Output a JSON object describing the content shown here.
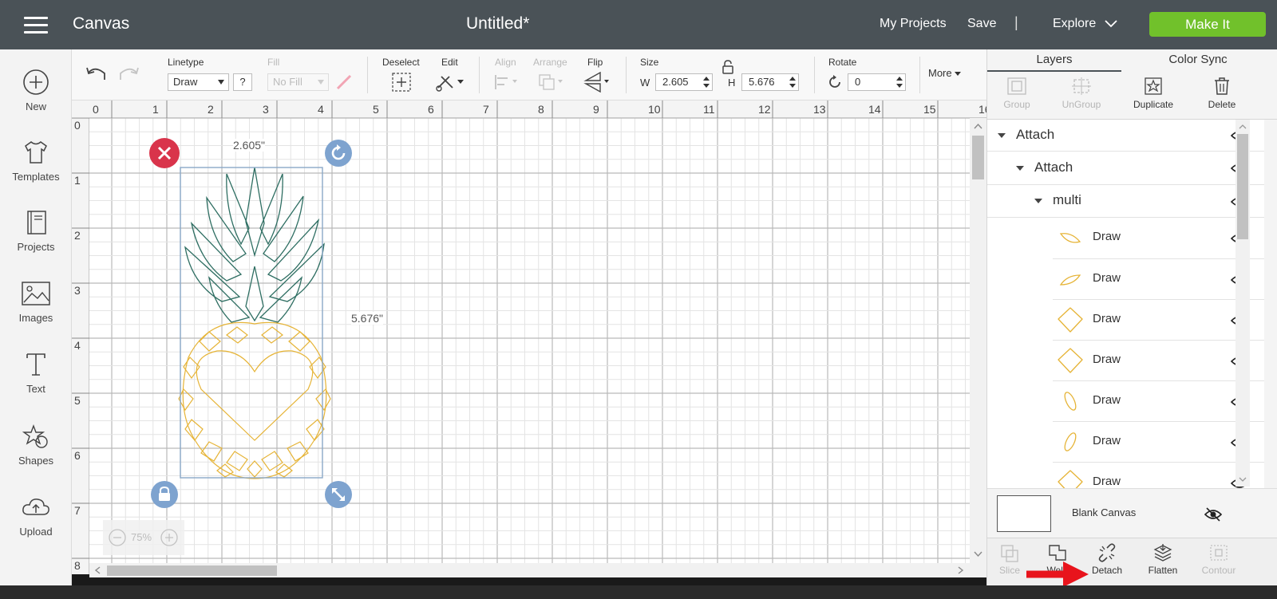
{
  "header": {
    "app_title": "Canvas",
    "doc_title": "Untitled*",
    "my_projects": "My Projects",
    "save": "Save",
    "separator": "|",
    "explore": "Explore",
    "make_it": "Make It",
    "make_it_color": "#71c12b"
  },
  "sidebar": {
    "items": [
      {
        "label": "New",
        "icon": "plus-circle-icon"
      },
      {
        "label": "Templates",
        "icon": "tshirt-icon"
      },
      {
        "label": "Projects",
        "icon": "book-icon"
      },
      {
        "label": "Images",
        "icon": "image-icon"
      },
      {
        "label": "Text",
        "icon": "text-icon"
      },
      {
        "label": "Shapes",
        "icon": "shapes-icon"
      },
      {
        "label": "Upload",
        "icon": "cloud-upload-icon"
      }
    ]
  },
  "toolbar": {
    "linetype_label": "Linetype",
    "linetype_value": "Draw",
    "help": "?",
    "fill_label": "Fill",
    "fill_value": "No Fill",
    "deselect": "Deselect",
    "edit": "Edit",
    "align": "Align",
    "arrange": "Arrange",
    "flip": "Flip",
    "size": "Size",
    "w_label": "W",
    "w_value": "2.605",
    "h_label": "H",
    "h_value": "5.676",
    "rotate": "Rotate",
    "rotate_value": "0",
    "more": "More"
  },
  "canvas": {
    "ruler_top": [
      "0",
      "1",
      "2",
      "3",
      "4",
      "5",
      "6",
      "7",
      "8",
      "9",
      "10",
      "11",
      "12",
      "13",
      "14",
      "15",
      "16"
    ],
    "ruler_left": [
      "0",
      "1",
      "2",
      "3",
      "4",
      "5",
      "6",
      "7",
      "8"
    ],
    "width_label": "2.605\"",
    "height_label": "5.676\"",
    "zoom": "75%",
    "leaves_color": "#2e6e62",
    "fruit_color": "#e6b437",
    "selection_color": "#8aa8c8",
    "delete_color": "#d9344b",
    "handle_color": "#7ea3cf"
  },
  "right_panel": {
    "tabs": [
      "Layers",
      "Color Sync"
    ],
    "tools": [
      {
        "label": "Group",
        "enabled": false
      },
      {
        "label": "UnGroup",
        "enabled": false
      },
      {
        "label": "Duplicate",
        "enabled": true
      },
      {
        "label": "Delete",
        "enabled": true
      }
    ],
    "layers": [
      {
        "label": "Attach",
        "level": 0
      },
      {
        "label": "Attach",
        "level": 1
      },
      {
        "label": "multi",
        "level": 2
      },
      {
        "label": "Draw",
        "level": 3,
        "thumb": "leaf-shape-icon"
      },
      {
        "label": "Draw",
        "level": 3,
        "thumb": "leaf-shape-icon"
      },
      {
        "label": "Draw",
        "level": 3,
        "thumb": "diamond-shape-icon"
      },
      {
        "label": "Draw",
        "level": 3,
        "thumb": "diamond-shape-icon"
      },
      {
        "label": "Draw",
        "level": 3,
        "thumb": "oval-shape-icon"
      },
      {
        "label": "Draw",
        "level": 3,
        "thumb": "oval-shape-icon"
      },
      {
        "label": "Draw",
        "level": 3,
        "thumb": "diamond-shape-icon"
      }
    ],
    "blank_canvas": "Blank Canvas",
    "bottom_tools": [
      {
        "label": "Slice",
        "enabled": false
      },
      {
        "label": "Weld",
        "enabled": true
      },
      {
        "label": "Detach",
        "enabled": true
      },
      {
        "label": "Flatten",
        "enabled": true
      },
      {
        "label": "Contour",
        "enabled": false
      }
    ]
  }
}
